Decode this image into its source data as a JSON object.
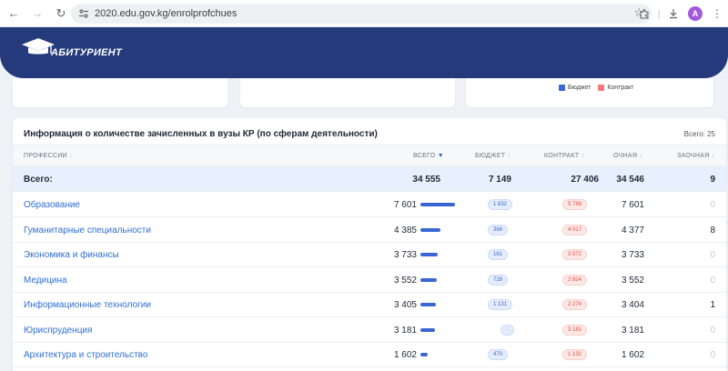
{
  "browser": {
    "url": "2020.edu.gov.kg/enrolprofchues",
    "avatar_letter": "A"
  },
  "header": {
    "logo_text": "АБИТУРИЕНТ",
    "bg_color": "#243a7a"
  },
  "top_cards": {
    "legend_budget": "Бюджет",
    "legend_contract": "Контракт",
    "budget_color": "#3a66d4",
    "contract_color": "#f27a7a"
  },
  "table": {
    "title": "Информация о количестве зачисленных в вузы КР (по сферам деятельности)",
    "count_label": "Всего: 25",
    "headers": {
      "profession": "ПРОФЕССИИ",
      "total": "ВСЕГО",
      "budget": "БЮДЖЕТ",
      "contract": "КОНТРАКТ",
      "fulltime": "ОЧНАЯ",
      "parttime": "ЗАОЧНАЯ"
    },
    "total_row": {
      "name": "Всего:",
      "total": "34 555",
      "budget": "7 149",
      "contract": "27 406",
      "fulltime": "34 546",
      "parttime": "9"
    },
    "rows": [
      {
        "name": "Образование",
        "total": "7 601",
        "share": 1.0,
        "budget": "1 832",
        "contract": "5 769",
        "fulltime": "7 601",
        "parttime": "0"
      },
      {
        "name": "Гуманитарные специальности",
        "total": "4 385",
        "share": 0.577,
        "budget": "368",
        "contract": "4 017",
        "fulltime": "4 377",
        "parttime": "8"
      },
      {
        "name": "Экономика и финансы",
        "total": "3 733",
        "share": 0.491,
        "budget": "161",
        "contract": "3 572",
        "fulltime": "3 733",
        "parttime": "0"
      },
      {
        "name": "Медицина",
        "total": "3 552",
        "share": 0.467,
        "budget": "728",
        "contract": "2 824",
        "fulltime": "3 552",
        "parttime": "0"
      },
      {
        "name": "Информационные технологии",
        "total": "3 405",
        "share": 0.448,
        "budget": "1 131",
        "contract": "2 274",
        "fulltime": "3 404",
        "parttime": "1"
      },
      {
        "name": "Юриспруденция",
        "total": "3 181",
        "share": 0.418,
        "budget": "0",
        "contract": "3 181",
        "fulltime": "3 181",
        "parttime": "0"
      },
      {
        "name": "Архитектура и строительство",
        "total": "1 602",
        "share": 0.211,
        "budget": "470",
        "contract": "1 132",
        "fulltime": "1 602",
        "parttime": "0"
      }
    ]
  }
}
